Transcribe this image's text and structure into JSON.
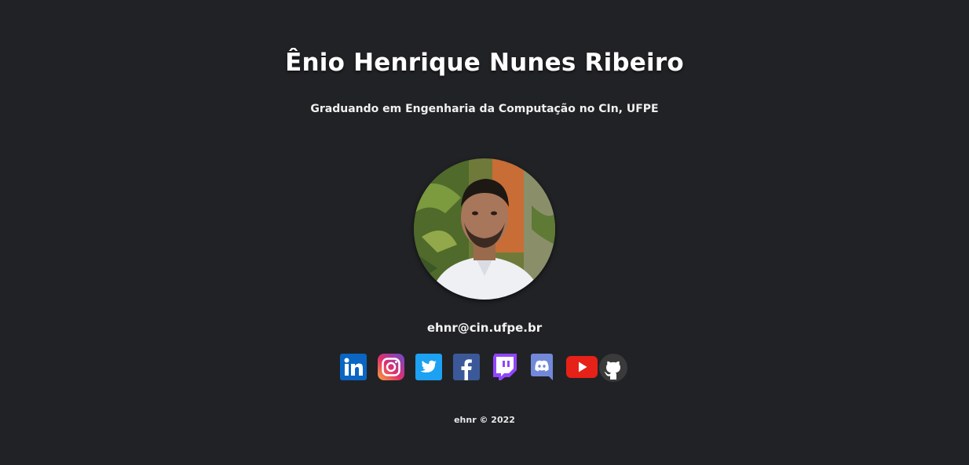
{
  "profile": {
    "name": "Ênio Henrique Nunes Ribeiro",
    "subtitle": "Graduando em Engenharia da Computação no CIn, UFPE",
    "email": "ehnr@cin.ufpe.br",
    "avatar_alt": "profile-photo"
  },
  "socials": [
    {
      "name": "linkedin",
      "icon": "linkedin-icon",
      "color": "#0A66C2"
    },
    {
      "name": "instagram",
      "icon": "instagram-icon",
      "color": "#E1306C"
    },
    {
      "name": "twitter",
      "icon": "twitter-icon",
      "color": "#1DA1F2"
    },
    {
      "name": "facebook",
      "icon": "facebook-icon",
      "color": "#3B5998"
    },
    {
      "name": "twitch",
      "icon": "twitch-icon",
      "color": "#9146FF"
    },
    {
      "name": "discord",
      "icon": "discord-icon",
      "color": "#7289DA"
    },
    {
      "name": "youtube",
      "icon": "youtube-icon",
      "color": "#E62117"
    },
    {
      "name": "github",
      "icon": "github-icon",
      "color": "#3a3a3a"
    }
  ],
  "footer": {
    "text": "ehnr © 2022"
  },
  "colors": {
    "background": "#212226",
    "text": "#ffffff"
  }
}
